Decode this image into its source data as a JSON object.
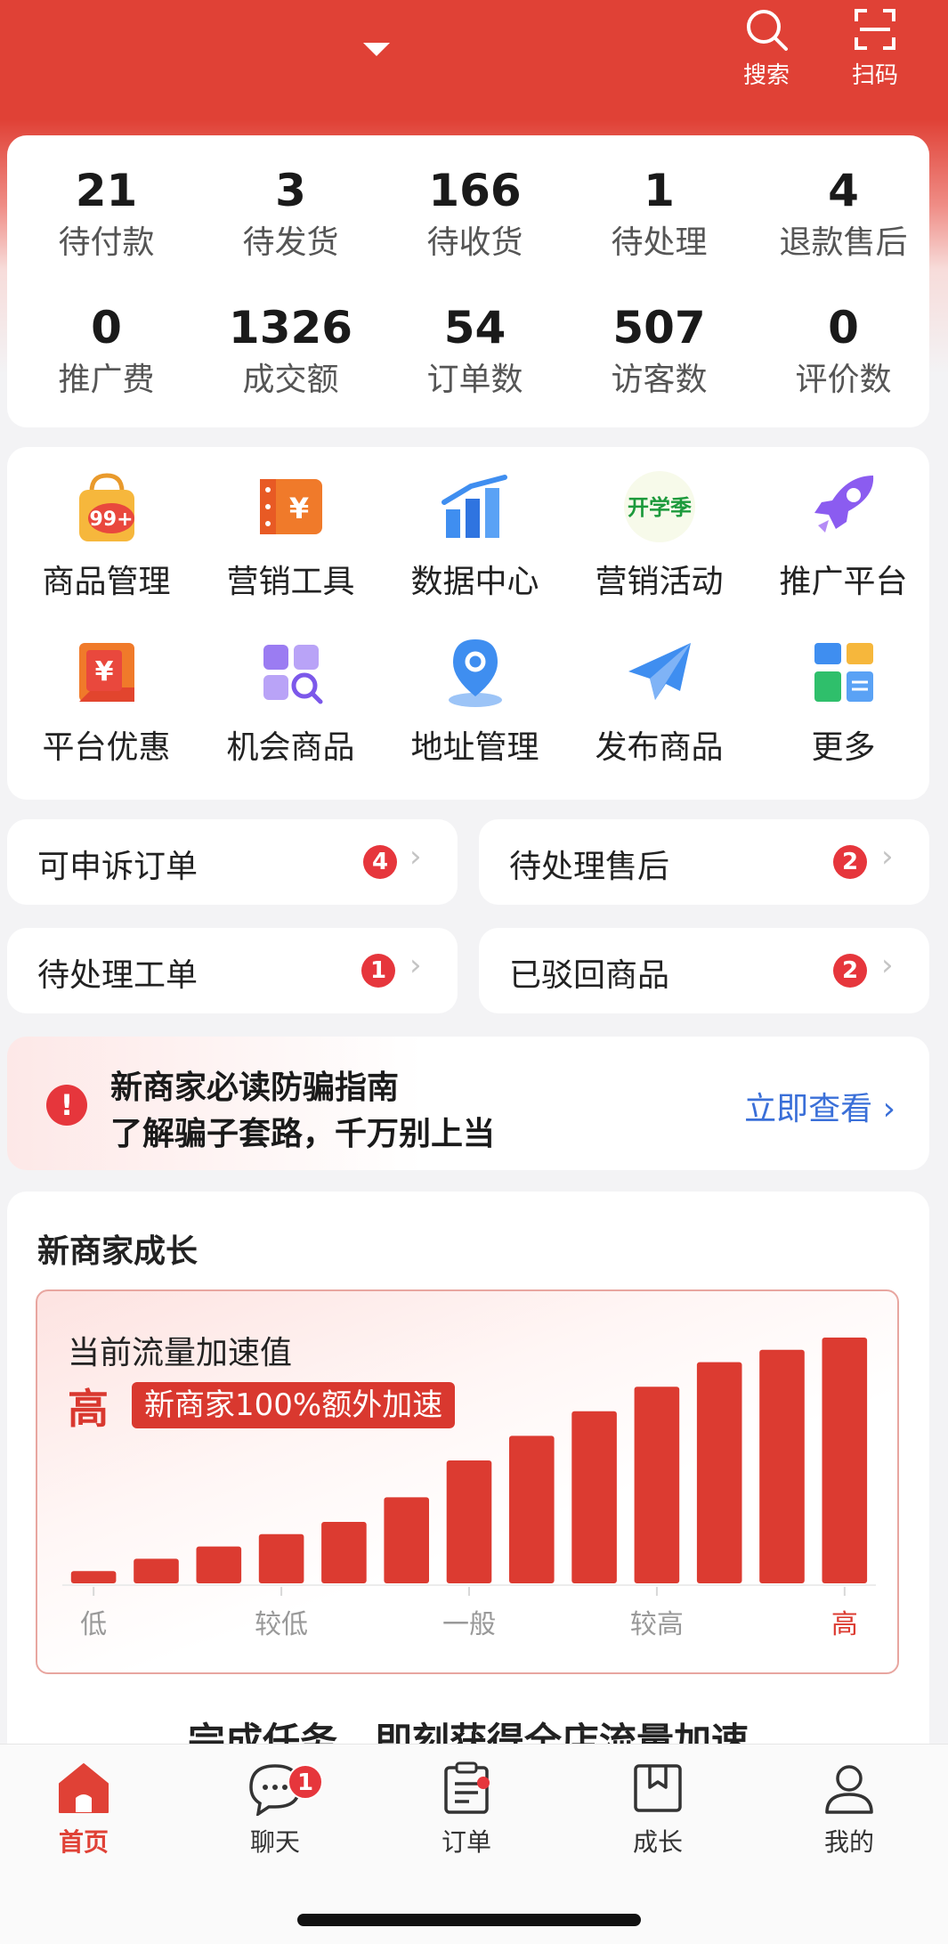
{
  "header": {
    "actions": [
      {
        "label": "搜索",
        "icon": "search-icon"
      },
      {
        "label": "扫码",
        "icon": "scan-icon"
      }
    ]
  },
  "stats": [
    {
      "value": "21",
      "label": "待付款"
    },
    {
      "value": "3",
      "label": "待发货"
    },
    {
      "value": "166",
      "label": "待收货"
    },
    {
      "value": "1",
      "label": "待处理"
    },
    {
      "value": "4",
      "label": "退款售后"
    },
    {
      "value": "0",
      "label": "推广费"
    },
    {
      "value": "1326",
      "label": "成交额"
    },
    {
      "value": "54",
      "label": "订单数"
    },
    {
      "value": "507",
      "label": "访客数"
    },
    {
      "value": "0",
      "label": "评价数"
    }
  ],
  "tools": [
    {
      "label": "商品管理",
      "icon": "shopping-bag-icon",
      "icon_text": "99+"
    },
    {
      "label": "营销工具",
      "icon": "coupon-icon",
      "icon_text": "¥"
    },
    {
      "label": "数据中心",
      "icon": "bar-chart-icon"
    },
    {
      "label": "营销活动",
      "icon": "school-season-icon",
      "icon_text": "开学季"
    },
    {
      "label": "推广平台",
      "icon": "rocket-icon"
    },
    {
      "label": "平台优惠",
      "icon": "discount-tag-icon",
      "icon_text": "¥"
    },
    {
      "label": "机会商品",
      "icon": "grid-search-icon"
    },
    {
      "label": "地址管理",
      "icon": "location-pin-icon"
    },
    {
      "label": "发布商品",
      "icon": "paper-plane-icon"
    },
    {
      "label": "更多",
      "icon": "more-apps-icon"
    }
  ],
  "quick_links": [
    {
      "label": "可申诉订单",
      "count": "4"
    },
    {
      "label": "待处理售后",
      "count": "2"
    },
    {
      "label": "待处理工单",
      "count": "1"
    },
    {
      "label": "已驳回商品",
      "count": "2"
    }
  ],
  "notice": {
    "title": "新商家必读防骗指南",
    "subtitle": "了解骗子套路，千万别上当",
    "link": "立即查看",
    "icon": "alert-icon"
  },
  "growth": {
    "title": "新商家成长",
    "subtitle": "当前流量加速值",
    "level": "高",
    "tag": "新商家100%额外加速",
    "cta": "完成任务，即刻获得全店流量加速"
  },
  "chart_data": {
    "type": "bar",
    "values": [
      1,
      2,
      3,
      4,
      5,
      7,
      10,
      12,
      14,
      16,
      18,
      19,
      20
    ],
    "tick_labels": [
      "低",
      "较低",
      "一般",
      "较高",
      "高"
    ],
    "highlight_tick": "高",
    "bar_color": "#dc3b31",
    "ylim": [
      0,
      20
    ]
  },
  "tabbar": {
    "tabs": [
      {
        "label": "首页",
        "icon": "home-icon",
        "active": true
      },
      {
        "label": "聊天",
        "icon": "chat-icon",
        "badge": "1"
      },
      {
        "label": "订单",
        "icon": "order-icon",
        "dot": true
      },
      {
        "label": "成长",
        "icon": "growth-book-icon"
      },
      {
        "label": "我的",
        "icon": "profile-icon"
      }
    ]
  },
  "colors": {
    "brand": "#e04136",
    "badge": "#e6363c",
    "link": "#3a6fd8"
  }
}
